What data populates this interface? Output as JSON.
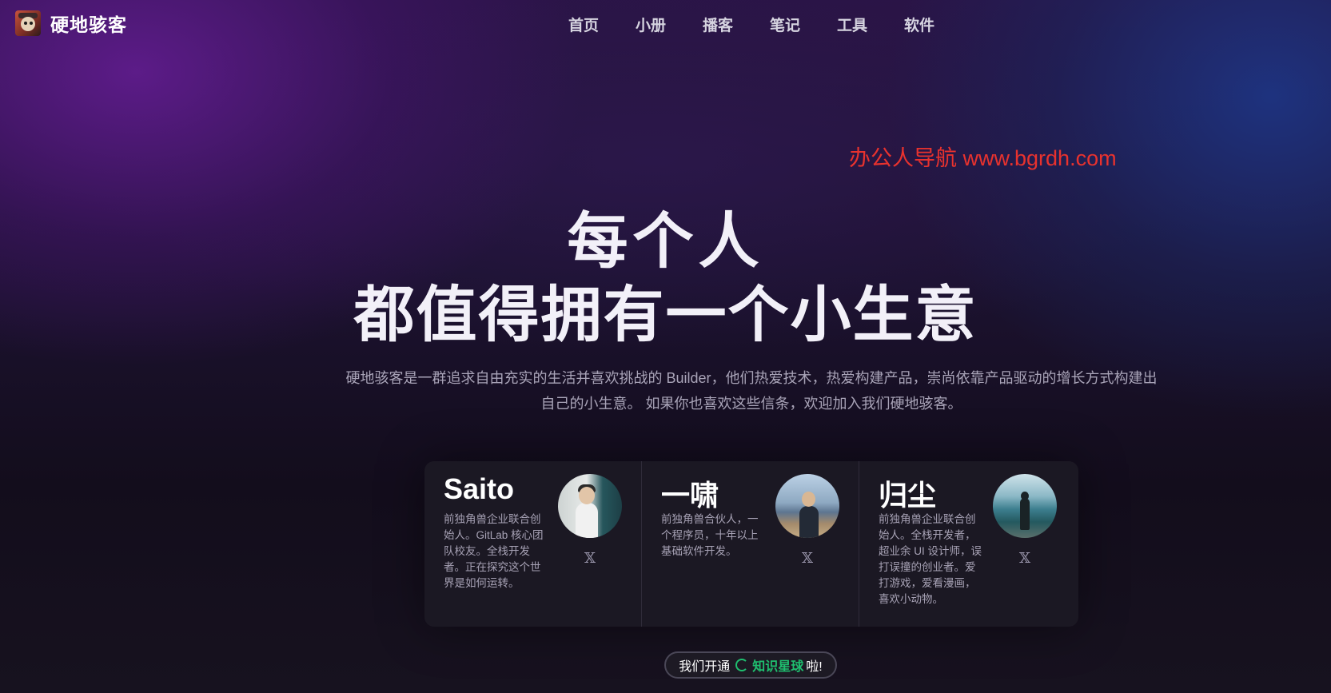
{
  "header": {
    "brand": "硬地骇客",
    "nav": [
      "首页",
      "小册",
      "播客",
      "笔记",
      "工具",
      "软件"
    ]
  },
  "watermark": "办公人导航  www.bgrdh.com",
  "hero": {
    "title_line1": "每个人",
    "title_line2": "都值得拥有一个小生意",
    "description_line1": "硬地骇客是一群追求自由充实的生活并喜欢挑战的 Builder，他们热爱技术，热爱构建产品，崇尚依靠产品驱动的增长方式构建出",
    "description_line2": "自己的小生意。 如果你也喜欢这些信条，欢迎加入我们硬地骇客。"
  },
  "members": [
    {
      "name": "Saito",
      "bio": "前独角兽企业联合创始人。GitLab 核心团队校友。全栈开发者。正在探究这个世界是如何运转。",
      "social_label": "𝕏"
    },
    {
      "name": "一啸",
      "bio": "前独角兽合伙人，一个程序员，十年以上基础软件开发。",
      "social_label": "𝕏"
    },
    {
      "name": "归尘",
      "bio": "前独角兽企业联合创始人。全栈开发者，超业余 UI 设计师，误打误撞的创业者。爱打游戏，爱看漫画，喜欢小动物。",
      "social_label": "𝕏"
    }
  ],
  "cta": {
    "prefix": "我们开通",
    "highlight": "知识星球",
    "suffix": "啦!"
  },
  "colors": {
    "accent_green": "#1fbf6f",
    "watermark_red": "#e8322e"
  },
  "icons": {
    "social": "x-logo-icon",
    "cta": "spinner-icon"
  }
}
